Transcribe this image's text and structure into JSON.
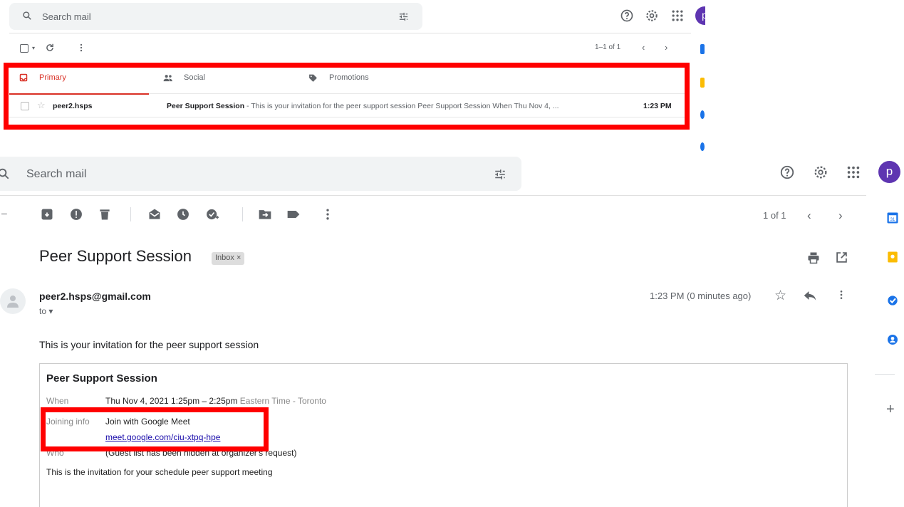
{
  "top_panel": {
    "search_placeholder": "Search mail",
    "avatar_letter": "p",
    "pagination": "1–1 of 1",
    "tabs": [
      {
        "label": "Primary",
        "icon": "inbox-icon",
        "active": true
      },
      {
        "label": "Social",
        "icon": "people-icon",
        "active": false
      },
      {
        "label": "Promotions",
        "icon": "tag-icon",
        "active": false
      }
    ],
    "email": {
      "sender": "peer2.hsps",
      "subject": "Peer Support Session",
      "snippet": " - This is your invitation for the peer support session Peer Support Session When Thu Nov 4, ...",
      "time": "1:23 PM"
    }
  },
  "main_panel": {
    "search_placeholder": "Search mail",
    "avatar_letter": "p",
    "pagination": "1 of 1",
    "subject": "Peer Support Session",
    "label_chip": "Inbox ×",
    "sender_email": "peer2.hsps@gmail.com",
    "to_label": "to ▾",
    "date": "1:23 PM (0 minutes ago)",
    "intro": "This is your invitation for the peer support session",
    "invitation": {
      "title": "Peer Support Session",
      "when_label": "When",
      "when_value": "Thu Nov 4, 2021 1:25pm – 2:25pm",
      "when_tz": "Eastern Time - Toronto",
      "joining_label": "Joining info",
      "joining_value": "Join with Google Meet",
      "meet_link": "meet.google.com/ciu-xtpq-hpe",
      "who_label": "Who",
      "who_value": "(Guest list has been hidden at organizer's request)",
      "footer": "This is the invitation for your schedule peer support meeting"
    },
    "rail_plus": "+"
  },
  "colors": {
    "accent_red": "#d93025",
    "highlight_red": "#ff0000",
    "avatar_purple": "#5e35b1",
    "link": "#1a0dab"
  }
}
